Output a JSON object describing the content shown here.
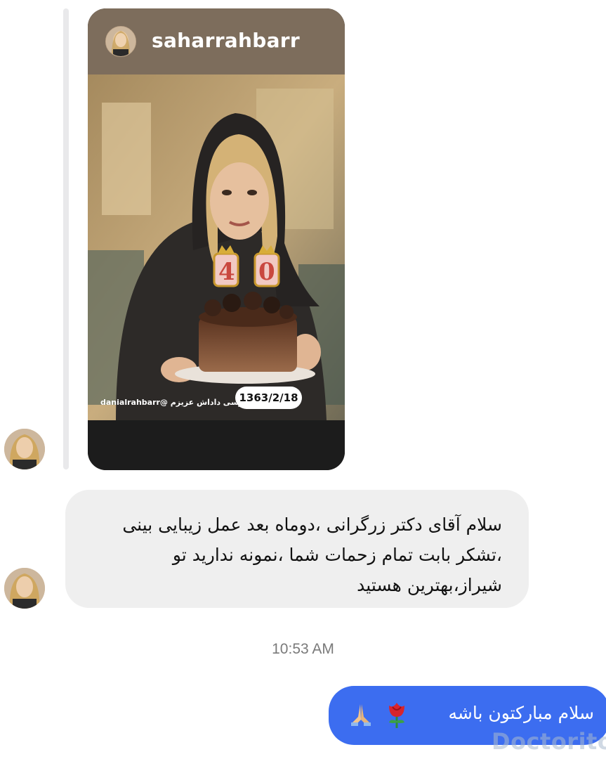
{
  "shared_story": {
    "username": "saharrahbarr",
    "caption": "danialrahbarr@ مرسی داداش عزیزم",
    "date_label": "1363/2/18",
    "cake_number": "40"
  },
  "messages": {
    "incoming_text": "سلام آقای دکتر زرگرانی ،دوماه بعد عمل زیبایی بینی ،تشکر بابت تمام زحمات شما ،نمونه ندارید تو شیراز،بهترین هستید",
    "timestamp": "10:53 AM",
    "outgoing_text": "سلام مبارکتون باشه"
  },
  "watermark": "Doctorito",
  "colors": {
    "outgoing_bubble": "#3c6df0",
    "incoming_bubble": "#efefef",
    "story_header": "#7d6d5c"
  }
}
